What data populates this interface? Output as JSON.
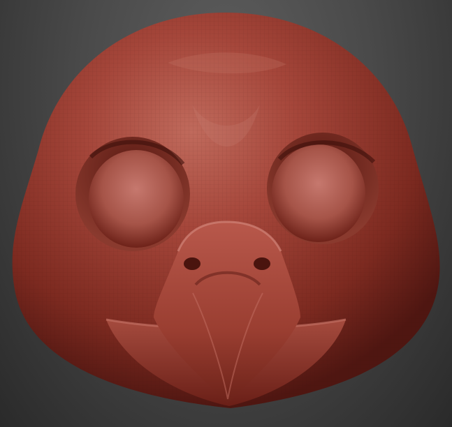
{
  "viewport": {
    "background_top": "#5e5e5e",
    "background_bottom": "#2a2a2a"
  },
  "model": {
    "icon": "sculpted-bird-head",
    "material_color": "#9a3a2c",
    "highlight_color": "#c4685a",
    "shadow_color": "#4a1510",
    "wireframe": true
  }
}
